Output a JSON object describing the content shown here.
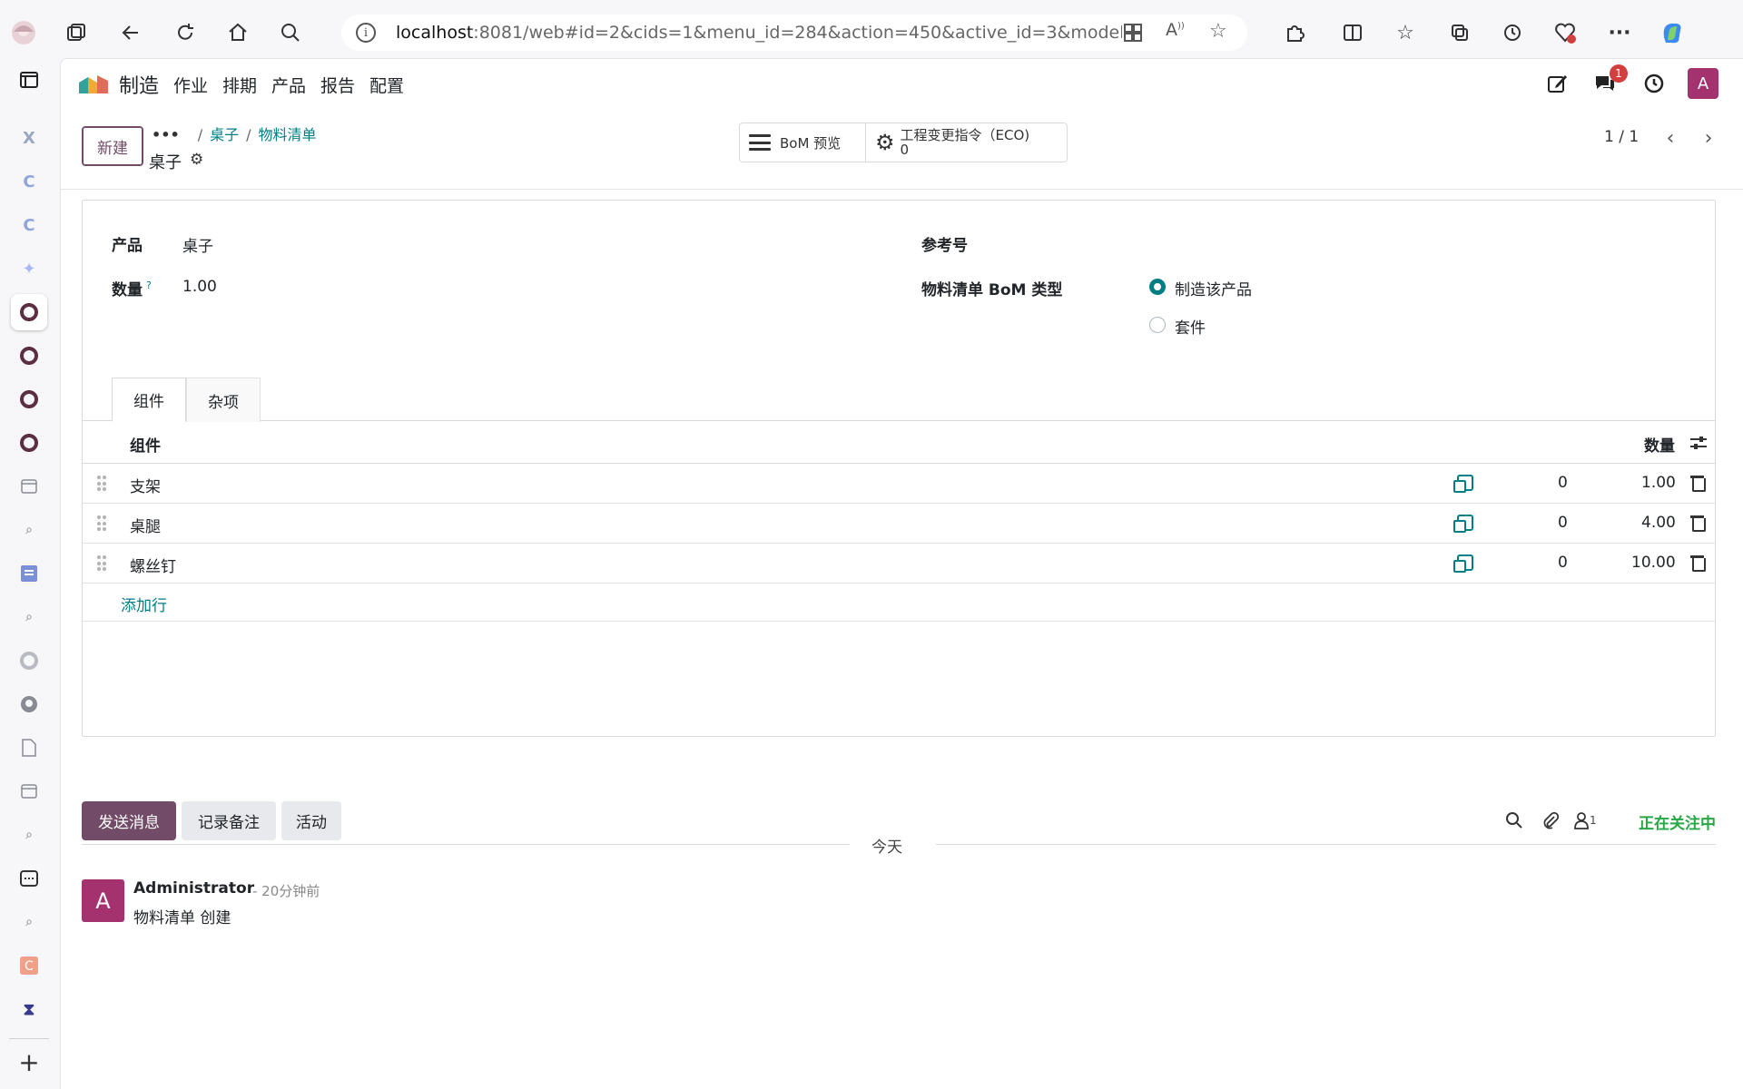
{
  "browser": {
    "url_host": "localhost",
    "url_rest": ":8081/web#id=2&cids=1&menu_id=284&action=450&active_id=3&model=mrp...."
  },
  "nav": {
    "app_name": "制造",
    "menu": [
      "作业",
      "排期",
      "产品",
      "报告",
      "配置"
    ],
    "chat_badge": "1",
    "user_initial": "A"
  },
  "control": {
    "new_label": "新建",
    "breadcrumb_dots": "•••",
    "breadcrumb": [
      "桌子",
      "物料清单"
    ],
    "record_title": "桌子",
    "bom_preview": "BoM 预览",
    "eco_label": "工程变更指令（ECO)",
    "eco_count": "0",
    "pager": "1 / 1"
  },
  "form": {
    "product_label": "产品",
    "product_value": "桌子",
    "qty_label": "数量",
    "qty_help": "?",
    "qty_value": "1.00",
    "ref_label": "参考号",
    "bom_type_label": "物料清单 BoM 类型",
    "bom_type_options": [
      {
        "label": "制造该产品",
        "checked": true
      },
      {
        "label": "套件",
        "checked": false
      }
    ]
  },
  "tabs": [
    {
      "label": "组件",
      "active": true
    },
    {
      "label": "杂项",
      "active": false
    }
  ],
  "table": {
    "col_component": "组件",
    "col_qty": "数量",
    "rows": [
      {
        "name": "支架",
        "avail": "0",
        "qty": "1.00"
      },
      {
        "name": "桌腿",
        "avail": "0",
        "qty": "4.00"
      },
      {
        "name": "螺丝钉",
        "avail": "0",
        "qty": "10.00"
      }
    ],
    "add_line": "添加行"
  },
  "chatter": {
    "send_message": "发送消息",
    "log_note": "记录备注",
    "activity": "活动",
    "followers_count": "1",
    "following": "正在关注中",
    "date_divider": "今天",
    "message": {
      "avatar": "A",
      "author": "Administrator",
      "time": "- 20分钟前",
      "body": "物料清单 创建"
    }
  },
  "colors": {
    "primary": "#714b67",
    "link": "#017e84",
    "avatar": "#a3326f",
    "following": "#28a745"
  }
}
